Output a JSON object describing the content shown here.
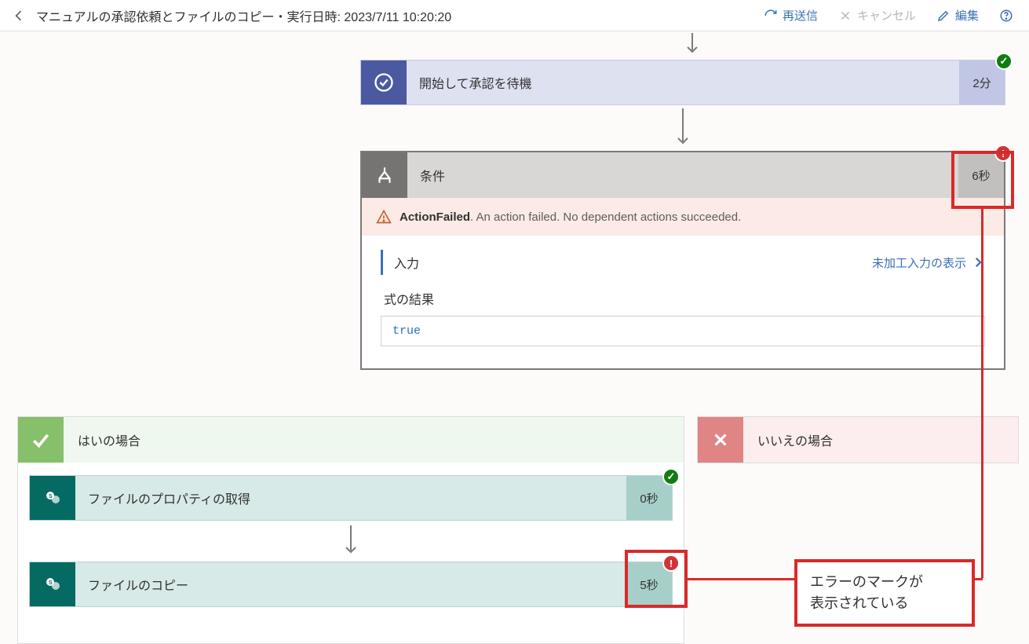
{
  "header": {
    "title": "マニュアルの承認依頼とファイルのコピー・実行日時: 2023/7/11 10:20:20",
    "resend": "再送信",
    "cancel": "キャンセル",
    "edit": "編集"
  },
  "step_approval": {
    "label": "開始して承認を待機",
    "duration": "2分"
  },
  "condition": {
    "label": "条件",
    "duration": "6秒",
    "error_code": "ActionFailed",
    "error_msg": ". An action failed. No dependent actions succeeded.",
    "input_label": "入力",
    "raw_link": "未加工入力の表示",
    "expr_label": "式の結果",
    "expr_value": "true"
  },
  "branch_yes": {
    "label": "はいの場合"
  },
  "branch_no": {
    "label": "いいえの場合"
  },
  "action_props": {
    "label": "ファイルのプロパティの取得",
    "duration": "0秒"
  },
  "action_copy": {
    "label": "ファイルのコピー",
    "duration": "5秒"
  },
  "callout": {
    "line1": "エラーのマークが",
    "line2": "表示されている"
  }
}
